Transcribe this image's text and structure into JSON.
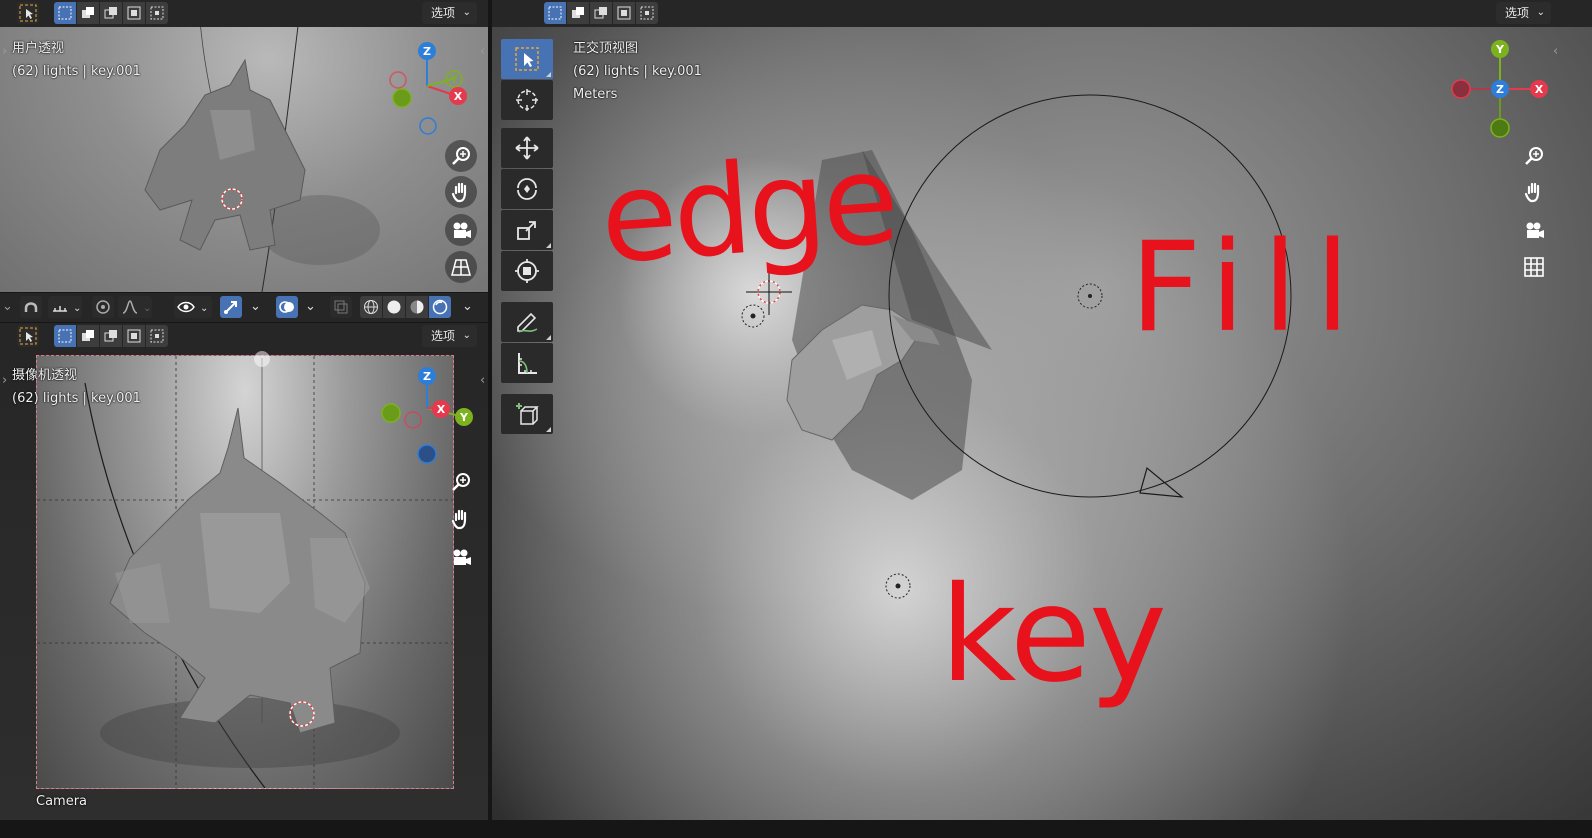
{
  "top_left_view": {
    "title": "用户透视",
    "subtitle": "(62) lights | key.001",
    "options_label": "选项"
  },
  "bottom_left_view": {
    "title": "摄像机透视",
    "subtitle": "(62) lights | key.001",
    "options_label": "选项",
    "camera_label": "Camera"
  },
  "right_view": {
    "title": "正交顶视图",
    "subtitle": "(62) lights | key.001",
    "units": "Meters",
    "options_label": "选项",
    "annotations": {
      "edge": "edge",
      "fill": "Fill",
      "key": "key"
    }
  },
  "gizmo_labels": {
    "x": "X",
    "y": "Y",
    "z": "Z"
  },
  "colors": {
    "accent": "#4772b3",
    "axis_x": "#e5394e",
    "axis_y": "#7db21f",
    "axis_z": "#2d7ed8",
    "annotation": "#e8121d",
    "header": "#262626",
    "selection_outline": "#e5a838"
  },
  "icons": {
    "select_tool": "select-cursor-icon",
    "cursor_tool": "3d-cursor-icon",
    "move_tool": "move-icon",
    "rotate_tool": "rotate-icon",
    "scale_tool": "scale-icon",
    "transform_tool": "transform-icon",
    "annotate_tool": "annotate-icon",
    "measure_tool": "measure-icon",
    "add_cube_tool": "add-cube-icon",
    "zoom": "zoom-icon",
    "pan": "hand-icon",
    "camera": "camera-icon",
    "grid": "grid-icon"
  }
}
